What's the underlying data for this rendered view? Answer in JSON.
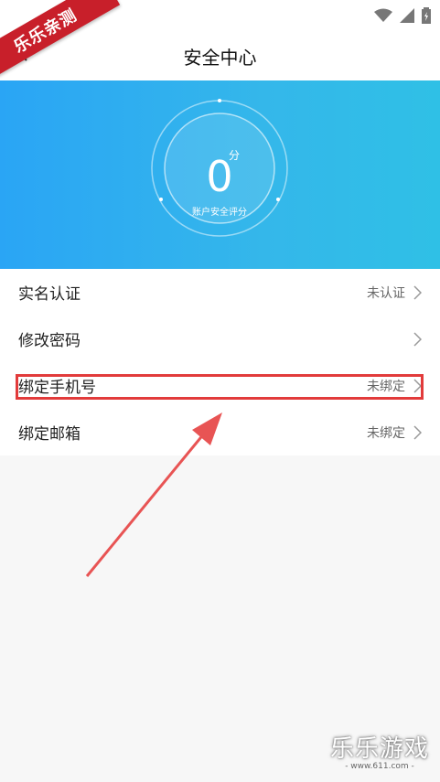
{
  "header": {
    "title": "安全中心"
  },
  "ribbon": {
    "text": "乐乐亲测"
  },
  "score": {
    "value": "0",
    "unit": "分",
    "label": "账户安全评分"
  },
  "rows": [
    {
      "label": "实名认证",
      "status": "未认证"
    },
    {
      "label": "修改密码",
      "status": ""
    },
    {
      "label": "绑定手机号",
      "status": "未绑定"
    },
    {
      "label": "绑定邮箱",
      "status": "未绑定"
    }
  ],
  "watermark": {
    "text": "乐乐游戏",
    "url": "- www.611.com -"
  },
  "colors": {
    "hero_start": "#2aa5f5",
    "hero_end": "#2fc0e6",
    "highlight": "#e23b3b",
    "ribbon": "#c81f2a"
  },
  "icons": {
    "back": "back-arrow-icon",
    "wifi": "wifi-icon",
    "signal": "signal-icon",
    "battery": "battery-icon",
    "chevron": "chevron-right-icon"
  }
}
